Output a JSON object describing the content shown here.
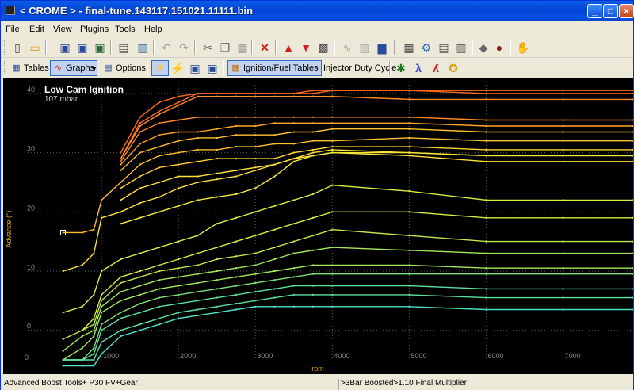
{
  "window": {
    "title": "< CROME > - final-tune.143117.151021.11111.bin",
    "minimize": "_",
    "maximize": "□",
    "close": "×"
  },
  "menu": [
    "File",
    "Edit",
    "View",
    "Plugins",
    "Tools",
    "Help"
  ],
  "toolbar2": {
    "tables_label": "Tables",
    "graphs_label": "Graphs",
    "dropdown": "▾",
    "options_label": "Options",
    "ignition_fuel_label": "Ignition/Fuel Tables",
    "injector_duty_label": "Injector Duty Cycle",
    "lambda_glyph": "λ"
  },
  "status": {
    "left": "Advanced Boost Tools+ P30 FV+Gear",
    "right": ">3Bar Boosted>1.10 Final Multiplier"
  },
  "chart_data": {
    "type": "line",
    "title": "Low Cam Ignition",
    "subtitle": "107 mbar",
    "xlabel": "rpm",
    "ylabel": "Advance (°)",
    "xlim": [
      0,
      7900
    ],
    "ylim": [
      -5,
      42
    ],
    "xticks": [
      1000,
      2000,
      3000,
      4000,
      5000,
      6000,
      7000
    ],
    "yticks": [
      0,
      10,
      20,
      30,
      40
    ],
    "x0_label": "0",
    "x": [
      500,
      750,
      900,
      1000,
      1250,
      1500,
      1750,
      2000,
      2250,
      2500,
      2750,
      3000,
      3250,
      3500,
      3750,
      4000,
      5000,
      6000,
      7000,
      7900
    ],
    "grid": true,
    "legend": "none",
    "colors": [
      "#ff6a1e",
      "#ff8c26",
      "#ffa52c",
      "#ffbf2e",
      "#ffd232",
      "#ffe23a",
      "#f2ea3a",
      "#dcea42",
      "#c0e84c",
      "#a2e65a",
      "#7fe07a",
      "#5ee0a0",
      "#4ae2c8"
    ],
    "series": [
      {
        "values": [
          null,
          null,
          null,
          null,
          30,
          36,
          38.5,
          39.5,
          40,
          40,
          40,
          40,
          40,
          40,
          40.5,
          40.5,
          40.5,
          40.5,
          40.5,
          40.5
        ]
      },
      {
        "values": [
          null,
          null,
          null,
          null,
          29,
          35,
          37,
          38.5,
          40,
          40,
          40,
          40,
          40,
          40,
          40,
          40.5,
          40.5,
          40,
          40,
          40
        ]
      },
      {
        "values": [
          null,
          null,
          null,
          null,
          29,
          34.5,
          36.5,
          38,
          39.5,
          39.5,
          39.5,
          39.5,
          39.5,
          39.5,
          39.5,
          39.5,
          39,
          39,
          39,
          39
        ]
      },
      {
        "values": [
          null,
          null,
          null,
          null,
          28.5,
          33.5,
          35,
          35.5,
          36,
          36,
          36,
          36,
          36,
          36,
          36,
          36,
          36,
          35.5,
          35.5,
          35.5
        ]
      },
      {
        "values": [
          null,
          null,
          null,
          null,
          28,
          31.5,
          33,
          33.5,
          33.5,
          34,
          34.5,
          34.5,
          35,
          35,
          35,
          35,
          35,
          34.5,
          34.5,
          34.5
        ]
      },
      {
        "values": [
          null,
          null,
          null,
          null,
          27,
          30,
          31,
          32,
          32.5,
          32.5,
          33,
          33,
          33,
          33.5,
          33.5,
          34,
          34,
          33.5,
          33.5,
          33.5
        ]
      },
      {
        "values": [
          16.5,
          16.5,
          17,
          22,
          25,
          28,
          29.5,
          30,
          30.5,
          30.5,
          31,
          31,
          31.5,
          31.5,
          32,
          32,
          32.5,
          32,
          32,
          32
        ]
      },
      {
        "values": [
          null,
          null,
          null,
          null,
          24,
          26,
          27.5,
          28,
          28.5,
          29,
          29,
          29,
          29,
          30,
          30.5,
          31,
          31,
          30.5,
          30.5,
          30.5
        ]
      },
      {
        "values": [
          null,
          null,
          null,
          null,
          22,
          24,
          25,
          26,
          26,
          26.5,
          27,
          27.5,
          28,
          29,
          30,
          30.5,
          30,
          29.5,
          29.5,
          29.5
        ]
      },
      {
        "values": [
          10,
          11,
          13,
          19,
          20,
          21.5,
          22.5,
          24,
          25,
          25.5,
          26,
          27,
          28,
          29,
          29.5,
          30,
          29.5,
          28.5,
          28.5,
          28.5
        ]
      },
      {
        "values": [
          null,
          null,
          null,
          null,
          18,
          19,
          20,
          21,
          22,
          22.5,
          23,
          24,
          26,
          28.5,
          29.5,
          30,
          30,
          29.5,
          29.5,
          29.5
        ]
      },
      {
        "values": [
          3,
          4,
          6,
          10,
          12,
          13,
          14,
          15,
          16,
          18,
          19,
          20,
          21,
          22,
          23,
          24.5,
          23.5,
          22,
          22,
          22
        ]
      },
      {
        "values": [
          null,
          0,
          2,
          6,
          9,
          10,
          11,
          12,
          13,
          14,
          15,
          16,
          17,
          18,
          19,
          20,
          20,
          19,
          19,
          19
        ]
      },
      {
        "values": [
          -1.5,
          0,
          1,
          5,
          8,
          9,
          10,
          10.5,
          11,
          12,
          12.5,
          13,
          14,
          15,
          16,
          17,
          16,
          15,
          15,
          15
        ]
      },
      {
        "values": [
          -3.5,
          -1,
          0,
          4,
          6.5,
          7.5,
          8.5,
          9,
          9.5,
          10,
          10.5,
          11,
          12,
          13,
          13.5,
          14,
          13.5,
          13,
          13,
          13
        ]
      },
      {
        "values": [
          -5,
          -3,
          -1,
          3,
          5,
          6,
          7,
          7.5,
          8,
          8.5,
          9,
          9.5,
          10,
          10.5,
          11,
          11,
          11,
          10.5,
          10.5,
          10.5
        ]
      },
      {
        "values": [
          -5,
          -5,
          -3,
          1,
          3,
          4.5,
          5.5,
          6,
          6.5,
          7,
          7.5,
          8,
          8.5,
          9,
          9.5,
          9.5,
          9.5,
          9.5,
          9.5,
          9.5
        ]
      },
      {
        "values": [
          -5,
          -5,
          -4,
          0,
          2,
          3,
          4,
          4.5,
          5,
          5.5,
          6,
          6.5,
          7,
          7.5,
          7.5,
          7.5,
          7.5,
          7,
          7,
          7
        ]
      },
      {
        "values": [
          -5,
          -5,
          -5,
          -2,
          0,
          1,
          2,
          3,
          3.5,
          4,
          4.5,
          5,
          5.5,
          6,
          6,
          6,
          6,
          5.5,
          5.5,
          5.5
        ]
      },
      {
        "values": [
          -6,
          -6,
          -6,
          -4,
          -1,
          0,
          1,
          2,
          2.5,
          3,
          3.5,
          4,
          4,
          4,
          4,
          4,
          4,
          3.5,
          3.5,
          3.5
        ]
      }
    ]
  }
}
